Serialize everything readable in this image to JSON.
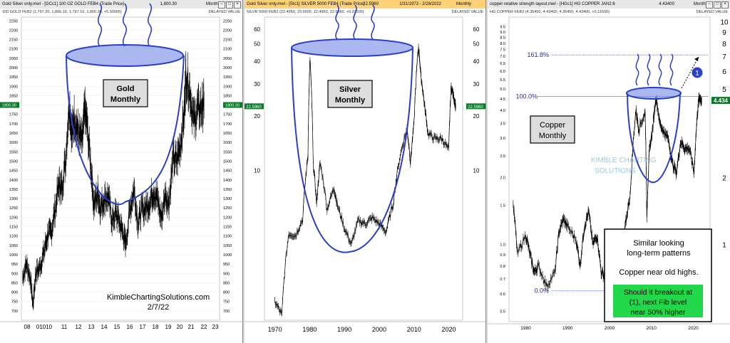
{
  "panels": [
    {
      "id": "gold",
      "window_title": "Gold Silver only.mwl - [GCc1] 100 OZ GOLD FEB4 (Trade Price)",
      "title_value": "1,800.30",
      "period": "Monthly",
      "subtitle": "100 GOLD FEB2 (1,797.20, 1,806.10, 1,797.10, 1,800.30, +5.30005)",
      "delayed": "DELAYED VALUE",
      "price_tag": "1800.30"
    },
    {
      "id": "silver",
      "window_title": "Gold Silver only.mwl - [SIc1] SILVER 5000 FEB4 (Trade Price)",
      "title_value": "22.5960",
      "title_extra": "1/31/1973 - 2/28/2022",
      "period": "Monthly",
      "subtitle": "SILVR 5000 FEB2 (22.4950, 23.0000, 22.4950, 22.5960, +0.20100)",
      "delayed": "DELAYED VALUE",
      "price_tag": "22.5960"
    },
    {
      "id": "copper",
      "window_title": "copper relative strength layout.mwl - [HGc1] HG COPPER JAN2:6",
      "title_value": "4.43400",
      "period": "Monthly",
      "subtitle": "HG COPPER FEB2 (4.35450, 4.43400, 4.35450, 4.43400, +0.11600)",
      "delayed": "DELAYED VALUE",
      "price_tag": "4.434"
    }
  ],
  "chart_data": [
    {
      "type": "line",
      "title": "Gold Monthly",
      "watermark": "KimbleChartingSolutions.com",
      "date": "2/7/22",
      "x_labels": [
        "08",
        "01010",
        "11",
        "12",
        "13",
        "14",
        "15",
        "16",
        "17",
        "18",
        "19",
        "20",
        "21",
        "22",
        "23"
      ],
      "y_ticks": [
        700,
        750,
        800,
        850,
        900,
        950,
        1000,
        1050,
        1100,
        1150,
        1200,
        1250,
        1300,
        1350,
        1400,
        1450,
        1500,
        1550,
        1600,
        1650,
        1700,
        1750,
        1800,
        1850,
        1900,
        1950,
        2000,
        2050,
        2100,
        2150,
        2200,
        2250
      ],
      "ylim": [
        650,
        2270
      ],
      "xlim": [
        2007.9,
        2023.2
      ],
      "series": [
        {
          "x": [
            2008.0,
            2008.3,
            2008.6,
            2008.8,
            2009.0,
            2009.3,
            2009.6,
            2009.9,
            2010.2,
            2010.5,
            2010.8,
            2011.0,
            2011.3,
            2011.6,
            2011.8,
            2012.0,
            2012.3,
            2012.6,
            2012.8,
            2013.0,
            2013.3,
            2013.5,
            2013.8,
            2014.0,
            2014.3,
            2014.6,
            2014.9,
            2015.2,
            2015.5,
            2015.8,
            2015.95,
            2016.3,
            2016.6,
            2016.9,
            2017.2,
            2017.5,
            2017.8,
            2018.1,
            2018.4,
            2018.7,
            2019.0,
            2019.3,
            2019.6,
            2019.9,
            2020.2,
            2020.5,
            2020.6,
            2020.9,
            2021.2,
            2021.5,
            2021.8,
            2022.0
          ],
          "y": [
            880,
            950,
            870,
            730,
            900,
            930,
            1000,
            1100,
            1120,
            1240,
            1380,
            1350,
            1500,
            1820,
            1640,
            1740,
            1650,
            1600,
            1780,
            1670,
            1450,
            1260,
            1330,
            1250,
            1300,
            1310,
            1180,
            1220,
            1170,
            1100,
            1060,
            1250,
            1350,
            1170,
            1240,
            1250,
            1280,
            1340,
            1300,
            1190,
            1320,
            1280,
            1510,
            1500,
            1600,
            1780,
            1970,
            1880,
            1710,
            1780,
            1780,
            1800
          ]
        }
      ]
    },
    {
      "type": "line",
      "title": "Silver Monthly",
      "y_scale": "log",
      "x_labels": [
        "1970",
        "1980",
        "1990",
        "2000",
        "2010",
        "2020"
      ],
      "y_ticks": [
        10,
        20,
        30,
        40,
        50,
        60
      ],
      "ylim": [
        1.5,
        70
      ],
      "xlim": [
        1967,
        2024
      ],
      "series": [
        {
          "x": [
            1970,
            1972,
            1974,
            1976,
            1978,
            1979.5,
            1980.1,
            1981,
            1982,
            1983,
            1985,
            1987,
            1988,
            1990,
            1992,
            1994,
            1996,
            1998,
            2000,
            2002,
            2004,
            2006,
            2008,
            2009,
            2010,
            2011.3,
            2012,
            2013,
            2014,
            2016,
            2018,
            2020,
            2020.7,
            2021.5,
            2022.0
          ],
          "y": [
            1.9,
            1.6,
            4.5,
            4.4,
            5.4,
            12,
            41,
            11,
            6.5,
            11,
            6.1,
            8,
            6.4,
            4.8,
            3.9,
            5.3,
            5.1,
            5.5,
            5.1,
            4.6,
            6.5,
            12,
            17,
            11,
            18,
            48,
            33,
            23,
            16,
            15,
            15,
            13,
            29,
            25,
            22.6
          ]
        }
      ]
    },
    {
      "type": "line",
      "title": "Copper Monthly",
      "y_scale": "log",
      "x_labels": [
        "1980",
        "1990",
        "2000",
        "2010",
        "2020"
      ],
      "y_ticks": [
        0.5,
        0.6,
        0.7,
        0.8,
        0.9,
        1.0,
        1.5,
        2.0,
        2.5,
        3.0,
        3.5,
        4.0,
        4.5,
        5.0,
        5.5,
        6.0,
        6.5,
        7.0,
        7.5,
        8.0,
        8.5,
        9.0,
        9.5
      ],
      "right_ticks": [
        1,
        2,
        3,
        4,
        5,
        6,
        7,
        8,
        9,
        10
      ],
      "ylim": [
        0.45,
        10.5
      ],
      "xlim": [
        1976,
        2024
      ],
      "series": [
        {
          "x": [
            1977,
            1978,
            1980,
            1981,
            1982,
            1983,
            1985,
            1987,
            1988,
            1989,
            1990,
            1992,
            1993,
            1994,
            1995,
            1996,
            1997,
            1998,
            1999,
            2000,
            2001,
            2002,
            2003,
            2004,
            2005,
            2006.3,
            2007,
            2008.5,
            2008.9,
            2009.5,
            2010.3,
            2011.1,
            2012,
            2013,
            2014,
            2015,
            2016,
            2017,
            2018,
            2019,
            2020.2,
            2021,
            2021.4,
            2022.0
          ],
          "y": [
            1.5,
            0.9,
            1.1,
            0.9,
            0.75,
            0.8,
            0.65,
            0.75,
            1.15,
            1.3,
            1.2,
            1.05,
            0.8,
            1.2,
            1.4,
            1.0,
            1.1,
            0.75,
            0.72,
            0.85,
            0.65,
            0.75,
            0.9,
            1.3,
            1.7,
            4.0,
            3.3,
            3.9,
            1.3,
            2.6,
            3.3,
            4.6,
            3.5,
            3.2,
            3.0,
            2.3,
            2.1,
            2.9,
            2.7,
            2.7,
            2.1,
            3.9,
            4.6,
            4.434
          ]
        }
      ],
      "fib_levels": [
        {
          "label": "161.8%",
          "value": 7.1
        },
        {
          "label": "100.0%",
          "value": 4.63
        },
        {
          "label": "0.0%",
          "value": 0.62
        }
      ],
      "marker_label": "1",
      "watermark_line1": "KIMBLE CHARTING",
      "watermark_line2": "SOLUTIONS",
      "note_lines": [
        "Similar looking",
        "long-term patterns",
        "Copper near old highs."
      ],
      "callout_lines": [
        "Should it breakout at",
        "(1), next Fib level",
        "near 50% higher"
      ]
    }
  ]
}
